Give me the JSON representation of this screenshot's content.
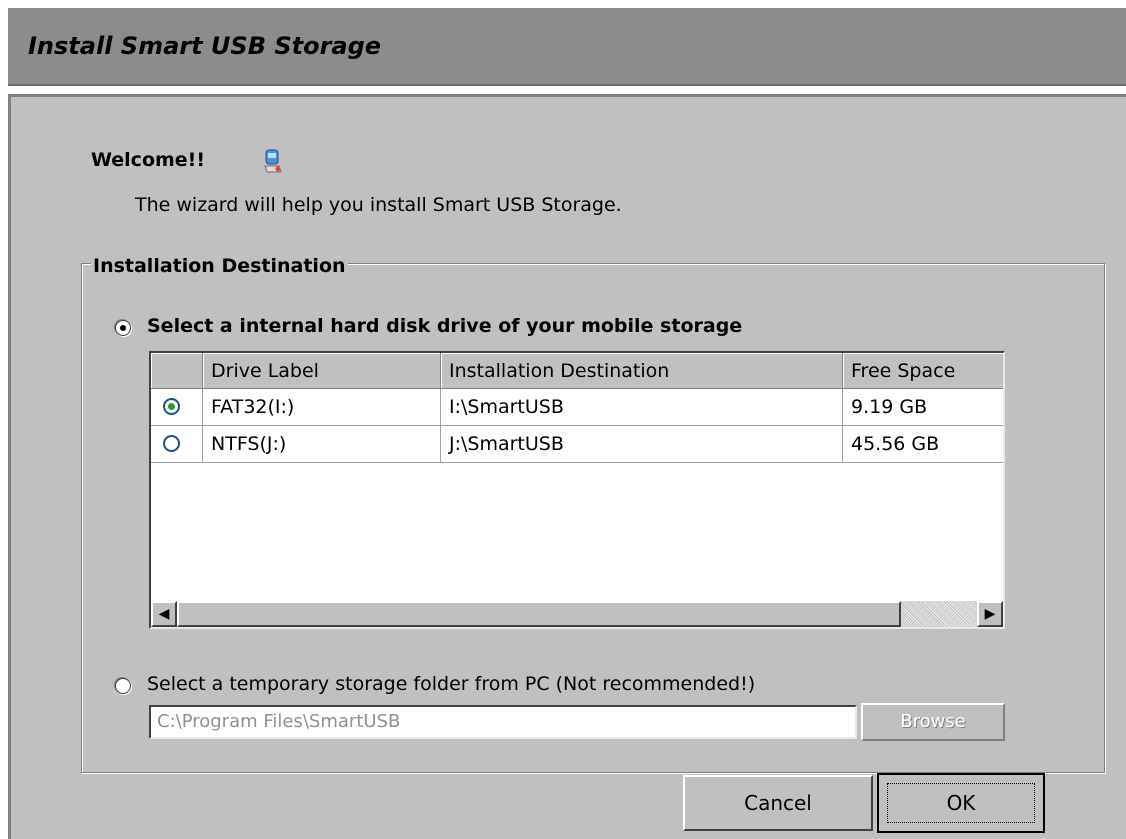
{
  "window": {
    "title": "Install Smart USB Storage"
  },
  "welcome": {
    "heading": "Welcome!!",
    "icon": "installer-icon",
    "message": "The wizard will help you install Smart USB Storage."
  },
  "destination": {
    "legend": "Installation Destination",
    "option_internal": {
      "label": "Select a internal hard disk drive of your mobile storage",
      "selected": true
    },
    "table": {
      "headers": [
        "",
        "Drive Label",
        "Installation Destination",
        "Free Space"
      ],
      "rows": [
        {
          "selected": true,
          "drive_label": "FAT32(I:)",
          "destination": "I:\\SmartUSB",
          "free_space": "9.19 GB"
        },
        {
          "selected": false,
          "drive_label": "NTFS(J:)",
          "destination": "J:\\SmartUSB",
          "free_space": "45.56 GB"
        }
      ]
    },
    "option_pc": {
      "label": "Select a temporary storage folder from PC (Not recommended!)",
      "selected": false,
      "path_value": "C:\\Program Files\\SmartUSB",
      "browse_label": "Browse"
    }
  },
  "buttons": {
    "cancel": "Cancel",
    "ok": "OK"
  }
}
